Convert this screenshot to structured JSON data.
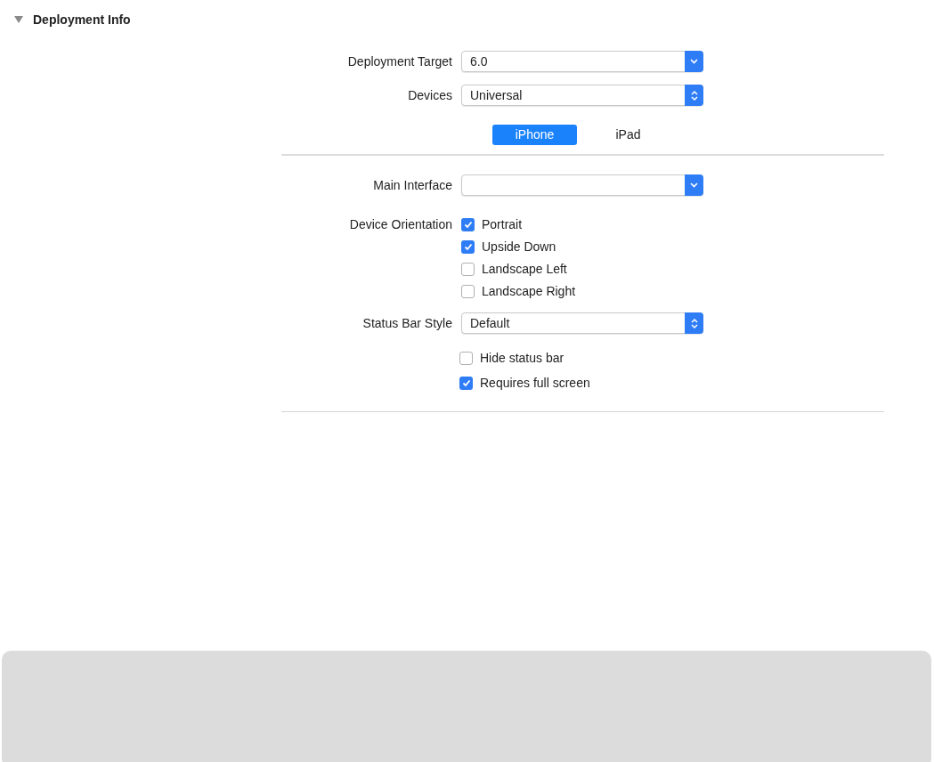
{
  "section": {
    "title": "Deployment Info",
    "expanded": true
  },
  "deployment_target": {
    "label": "Deployment Target",
    "kind": "pulldown",
    "value": "6.0"
  },
  "devices": {
    "label": "Devices",
    "kind": "popup",
    "value": "Universal"
  },
  "device_tabs": [
    {
      "label": "iPhone",
      "selected": true
    },
    {
      "label": "iPad",
      "selected": false
    }
  ],
  "main_interface": {
    "label": "Main Interface",
    "kind": "pulldown"
  },
  "device_orientation": {
    "label": "Device Orientation",
    "options": [
      {
        "label": "Portrait",
        "checked": true
      },
      {
        "label": "Upside Down",
        "checked": true
      },
      {
        "label": "Landscape Left",
        "checked": false
      },
      {
        "label": "Landscape Right",
        "checked": false
      }
    ]
  },
  "status_bar_style": {
    "label": "Status Bar Style",
    "kind": "popup",
    "value": "Default"
  },
  "status_bar_options": [
    {
      "label": "Hide status bar",
      "checked": false
    },
    {
      "label": "Requires full screen",
      "checked": true
    }
  ]
}
